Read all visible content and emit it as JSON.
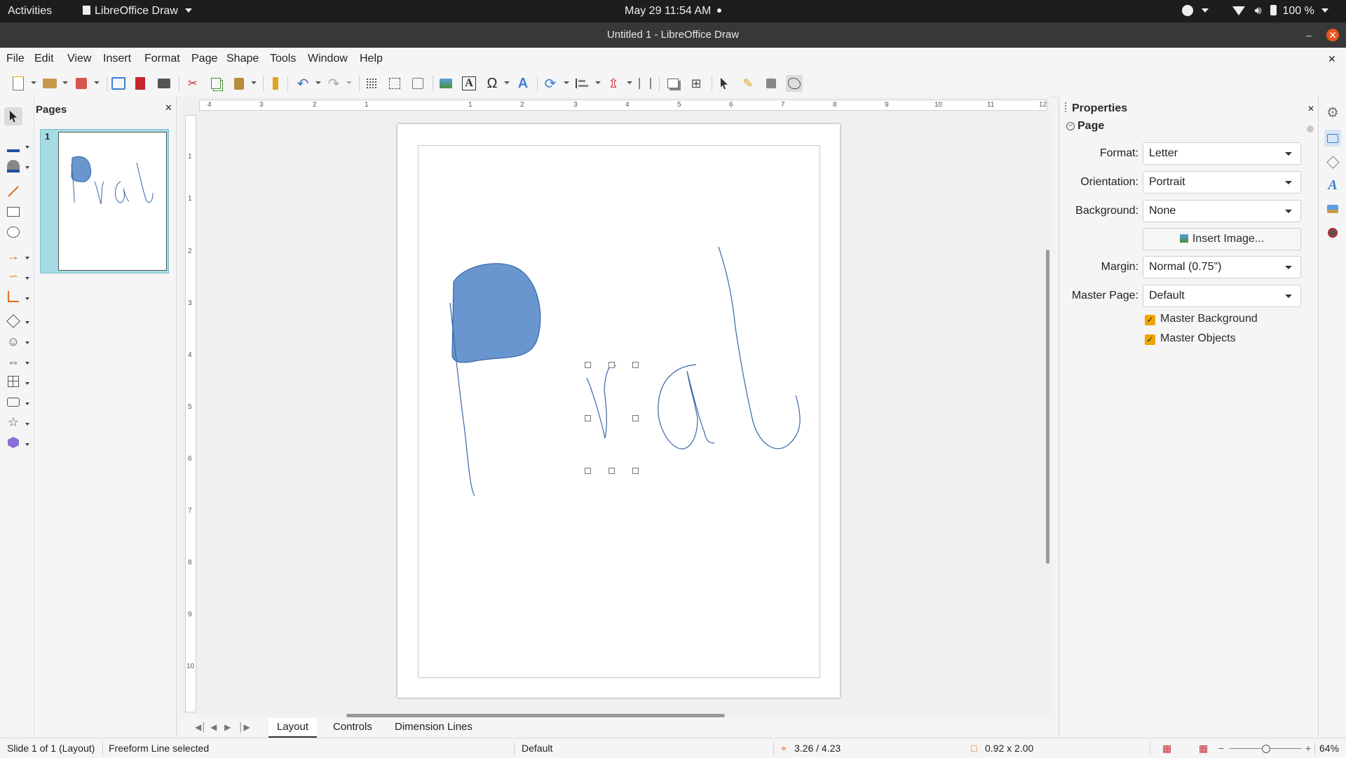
{
  "system_bar": {
    "activities": "Activities",
    "app_name": "LibreOffice Draw",
    "datetime": "May 29  11:54 AM",
    "battery": "100 %"
  },
  "window": {
    "title": "Untitled 1 - LibreOffice Draw"
  },
  "menubar": {
    "items": [
      "File",
      "Edit",
      "View",
      "Insert",
      "Format",
      "Page",
      "Shape",
      "Tools",
      "Window",
      "Help"
    ]
  },
  "pages_panel": {
    "title": "Pages",
    "thumbnail_number": "1"
  },
  "ruler": {
    "horizontal_labels": [
      "4",
      "3",
      "2",
      "1",
      "1",
      "2",
      "3",
      "4",
      "5",
      "6",
      "7",
      "8",
      "9",
      "10",
      "11",
      "12"
    ],
    "vertical_labels": [
      "1",
      "1",
      "2",
      "3",
      "4",
      "5",
      "6",
      "7",
      "8",
      "9",
      "10"
    ]
  },
  "sidebar": {
    "title": "Properties",
    "section": "Page",
    "format_label": "Format:",
    "format_value": "Letter",
    "orientation_label": "Orientation:",
    "orientation_value": "Portrait",
    "background_label": "Background:",
    "background_value": "None",
    "insert_image_label": "Insert Image...",
    "margin_label": "Margin:",
    "margin_value": "Normal (0.75\")",
    "master_page_label": "Master Page:",
    "master_page_value": "Default",
    "master_background_label": "Master Background",
    "master_background_checked": true,
    "master_objects_label": "Master Objects",
    "master_objects_checked": true
  },
  "tabs": {
    "items": [
      "Layout",
      "Controls",
      "Dimension Lines"
    ],
    "active": "Layout"
  },
  "statusbar": {
    "slide_info": "Slide 1 of 1 (Layout)",
    "selection_info": "Freeform Line selected",
    "master": "Default",
    "position": "3.26 / 4.23",
    "size": "0.92 x 2.00",
    "zoom": "64%"
  },
  "colors": {
    "accent_shape_fill": "#6a96cf",
    "stroke": "#3a66a8",
    "checkbox": "#f0a400",
    "thumbnail_bg": "#a6dbe3"
  }
}
